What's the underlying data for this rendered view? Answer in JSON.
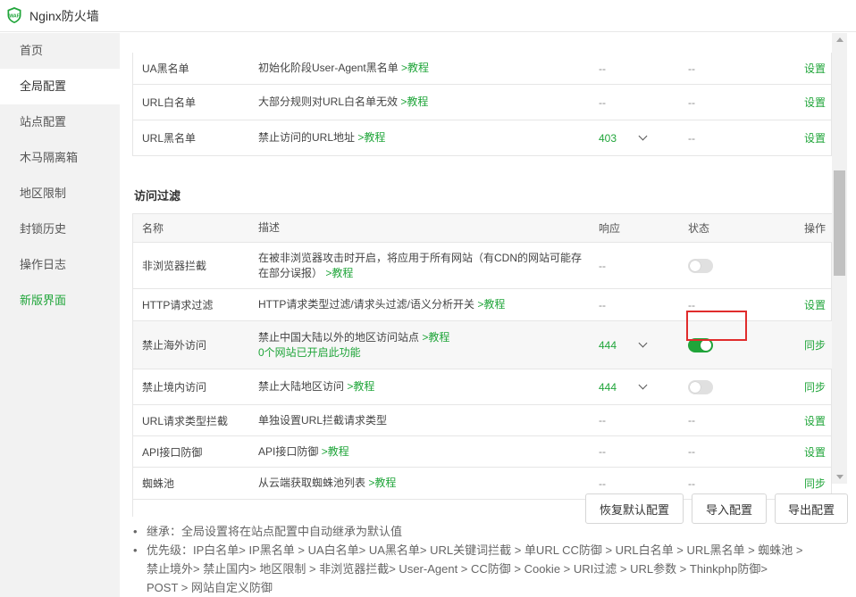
{
  "window": {
    "title": "Nginx防火墙",
    "logo_icon": "waf-shield-icon"
  },
  "sidebar": {
    "items": [
      {
        "label": "首页"
      },
      {
        "label": "全局配置"
      },
      {
        "label": "站点配置"
      },
      {
        "label": "木马隔离箱"
      },
      {
        "label": "地区限制"
      },
      {
        "label": "封锁历史"
      },
      {
        "label": "操作日志"
      },
      {
        "label": "新版界面"
      }
    ]
  },
  "top_rows": [
    {
      "name": "UA黑名单",
      "desc": "初始化阶段User-Agent黑名单",
      "tutorial": ">教程",
      "response": "--",
      "status": "--",
      "action": "设置"
    },
    {
      "name": "URL白名单",
      "desc": "大部分规则对URL白名单无效",
      "tutorial": ">教程",
      "response": "--",
      "status": "--",
      "action": "设置"
    },
    {
      "name": "URL黑名单",
      "desc": "禁止访问的URL地址",
      "tutorial": ">教程",
      "response": "403",
      "status": "--",
      "action": "设置"
    }
  ],
  "access_filter": {
    "title": "访问过滤",
    "headers": {
      "name": "名称",
      "desc": "描述",
      "response": "响应",
      "status": "状态",
      "action": "操作"
    },
    "rows": [
      {
        "name": "非浏览器拦截",
        "desc": "在被非浏览器攻击时开启，将应用于所有网站（有CDN的网站可能存",
        "desc2": "在部分误报）",
        "tutorial": ">教程",
        "response": "--",
        "status": "off",
        "action": ""
      },
      {
        "name": "HTTP请求过滤",
        "desc": "HTTP请求类型过滤/请求头过滤/语义分析开关",
        "tutorial": ">教程",
        "response": "--",
        "status": "--",
        "action": "设置"
      },
      {
        "name": "禁止海外访问",
        "desc": "禁止中国大陆以外的地区访问站点",
        "tutorial": ">教程",
        "note": "0个网站已开启此功能",
        "response": "444",
        "status": "on",
        "action": "同步"
      },
      {
        "name": "禁止境内访问",
        "desc": "禁止大陆地区访问",
        "tutorial": ">教程",
        "response": "444",
        "status": "off",
        "action": "同步"
      },
      {
        "name": "URL请求类型拦截",
        "desc": "单独设置URL拦截请求类型",
        "response": "--",
        "status": "--",
        "action": "设置"
      },
      {
        "name": "API接口防御",
        "desc": "API接口防御",
        "tutorial": ">教程",
        "response": "--",
        "status": "--",
        "action": "设置"
      },
      {
        "name": "蜘蛛池",
        "desc": "从云端获取蜘蛛池列表",
        "tutorial": ">教程",
        "response": "--",
        "status": "--",
        "action": "同步"
      }
    ]
  },
  "buttons": {
    "restore": "恢复默认配置",
    "import": "导入配置",
    "export": "导出配置"
  },
  "notes": {
    "inherit": "继承：全局设置将在站点配置中自动继承为默认值",
    "priority_1": "优先级：IP白名单> IP黑名单 > UA白名单> UA黑名单> URL关键词拦截 > 单URL CC防御 > URL白名单 > URL黑名单 > 蜘蛛池 >",
    "priority_2": "禁止境外> 禁止国内> 地区限制 > 非浏览器拦截> User-Agent > CC防御 > Cookie > URI过滤 > URL参数 > Thinkphp防御>",
    "priority_3": "POST > 网站自定义防御"
  },
  "colors": {
    "accent": "#20a53a",
    "highlight_border": "#e02c2c",
    "sidebar_bg": "#f2f2f2"
  }
}
